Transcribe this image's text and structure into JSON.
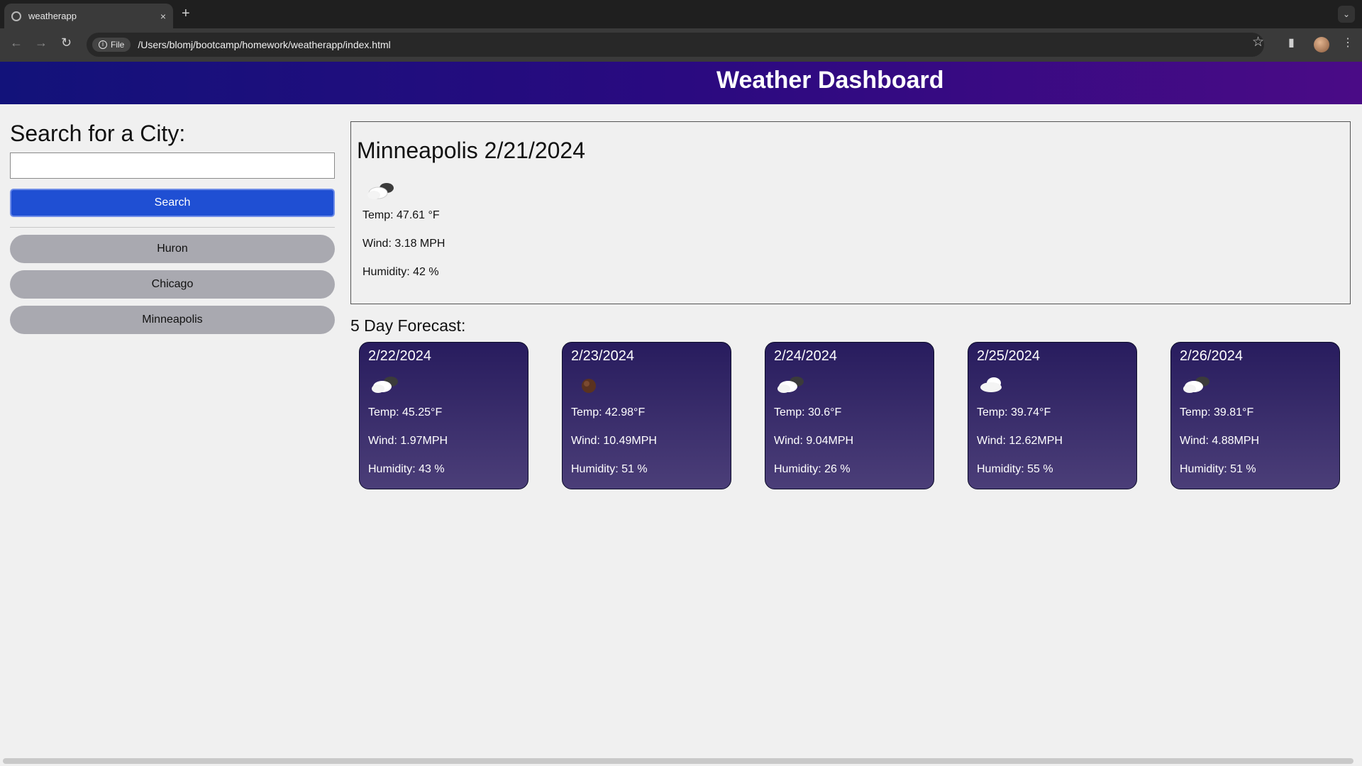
{
  "browser": {
    "tab_title": "weatherapp",
    "tab_close": "×",
    "new_tab": "+",
    "url_chip": "File",
    "url": "/Users/blomj/bootcamp/homework/weatherapp/index.html",
    "icons": {
      "back": "back-arrow-icon",
      "forward": "forward-arrow-icon",
      "reload": "reload-icon",
      "bookmark": "star-icon",
      "side_panel": "side-panel-icon",
      "menu": "kebab-menu-icon"
    }
  },
  "header": {
    "title": "Weather Dashboard"
  },
  "sidebar": {
    "heading": "Search for a City:",
    "search_value": "",
    "search_button": "Search",
    "history": [
      "Huron",
      "Chicago",
      "Minneapolis"
    ]
  },
  "current": {
    "title": "Minneapolis 2/21/2024",
    "icon": "partly-cloudy-night-icon",
    "temp": "Temp: 47.61 °F",
    "wind": "Wind: 3.18 MPH",
    "humidity": "Humidity: 42 %"
  },
  "forecast": {
    "title": "5 Day Forecast:",
    "days": [
      {
        "date": "2/22/2024",
        "icon": "partly-cloudy-night-icon",
        "temp": "Temp: 45.25°F",
        "wind": "Wind: 1.97MPH",
        "humidity": "Humidity: 43 %"
      },
      {
        "date": "2/23/2024",
        "icon": "clear-night-icon",
        "temp": "Temp: 42.98°F",
        "wind": "Wind: 10.49MPH",
        "humidity": "Humidity: 51 %"
      },
      {
        "date": "2/24/2024",
        "icon": "partly-cloudy-night-icon",
        "temp": "Temp: 30.6°F",
        "wind": "Wind: 9.04MPH",
        "humidity": "Humidity: 26 %"
      },
      {
        "date": "2/25/2024",
        "icon": "cloud-icon",
        "temp": "Temp: 39.74°F",
        "wind": "Wind: 12.62MPH",
        "humidity": "Humidity: 55 %"
      },
      {
        "date": "2/26/2024",
        "icon": "partly-cloudy-night-icon",
        "temp": "Temp: 39.81°F",
        "wind": "Wind: 4.88MPH",
        "humidity": "Humidity: 51 %"
      }
    ]
  },
  "colors": {
    "header_start": "#12127a",
    "header_end": "#4a0b86",
    "search_button": "#1f4fd3",
    "history_button": "#a9a9b0",
    "card_top": "#281c5e",
    "card_bottom": "#4b3e78"
  }
}
